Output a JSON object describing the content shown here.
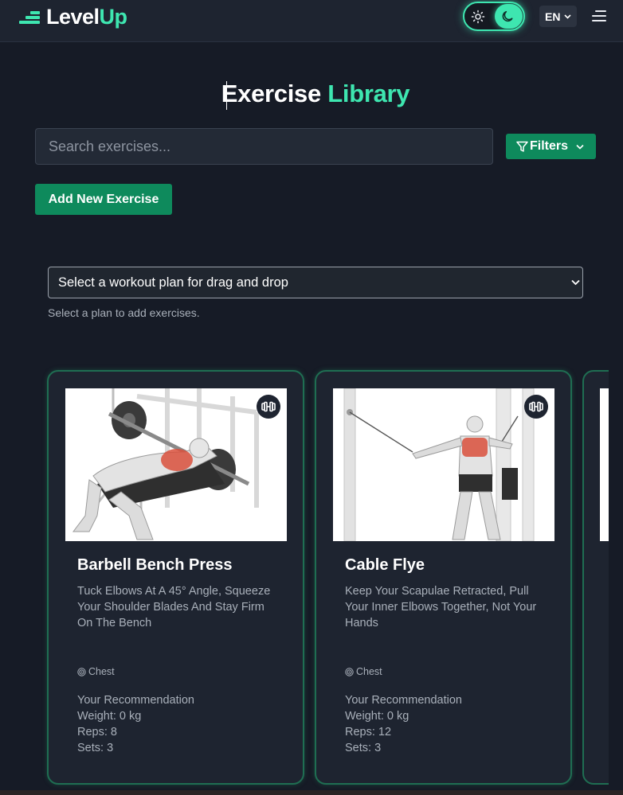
{
  "app": {
    "brand_first": "Level",
    "brand_second": "Up",
    "accent_color": "#3ee6b0",
    "button_color": "#0e8a5c"
  },
  "header": {
    "theme_toggle": {
      "light_icon": "sun-icon",
      "dark_icon": "moon-icon",
      "active": "dark"
    },
    "language": "EN",
    "menu_icon": "hamburger-icon"
  },
  "page": {
    "title_first": "Exercise",
    "title_second": "Library"
  },
  "search": {
    "placeholder": "Search exercises..."
  },
  "filters": {
    "label": "Filters"
  },
  "add_exercise": {
    "label": "Add New Exercise"
  },
  "plan_select": {
    "selected": "Select a workout plan for drag and drop",
    "hint": "Select a plan to add exercises."
  },
  "exercises": [
    {
      "name": "Barbell Bench Press",
      "description": "Tuck Elbows At A 45° Angle, Squeeze Your Shoulder Blades And Stay Firm On The Bench",
      "muscle": "Chest",
      "equipment_icon": "dumbbell-icon",
      "recommendation_label": "Your Recommendation",
      "weight": "Weight: 0 kg",
      "reps": "Reps: 8",
      "sets": "Sets: 3"
    },
    {
      "name": "Cable Flye",
      "description": "Keep Your Scapulae Retracted, Pull Your Inner Elbows Together, Not Your Hands",
      "muscle": "Chest",
      "equipment_icon": "dumbbell-icon",
      "recommendation_label": "Your Recommendation",
      "weight": "Weight: 0 kg",
      "reps": "Reps: 12",
      "sets": "Sets: 3"
    }
  ]
}
